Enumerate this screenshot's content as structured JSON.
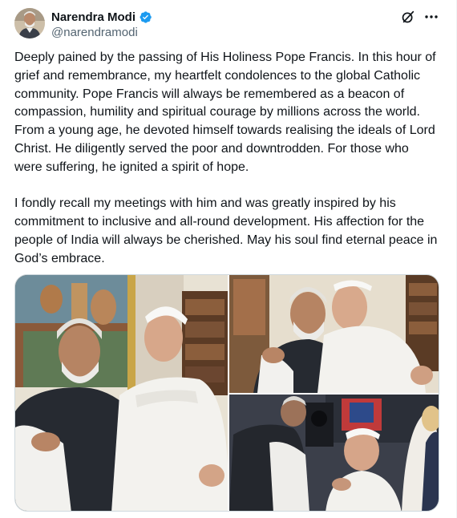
{
  "author": {
    "display_name": "Narendra Modi",
    "handle": "@narendramodi",
    "verified_icon": "verified-badge-icon"
  },
  "header_actions": {
    "grok_icon": "grok-icon",
    "more_icon": "more-options-icon"
  },
  "post": {
    "text": "Deeply pained by the passing of His Holiness Pope Francis. In this hour of grief and remembrance, my heartfelt condolences to the global Catholic community. Pope Francis will always be remembered as a beacon of compassion, humility and spiritual courage by millions across the world. From a young age, he devoted himself towards realising the ideals of Lord Christ. He diligently served the poor and downtrodden. For those who were suffering, he ignited a spirit of hope.\n\nI fondly recall my meetings with him and was greatly inspired by his commitment to inclusive and all-round development. His affection for the people of India will always be cherished. May his soul find eternal peace in God’s embrace."
  },
  "media": {
    "photos": [
      {
        "subject": "embrace-photo-main"
      },
      {
        "subject": "embrace-photo-closeup"
      },
      {
        "subject": "conversation-photo"
      }
    ]
  },
  "colors": {
    "text_primary": "#0f1419",
    "text_secondary": "#536471",
    "verified_blue": "#1d9bf0",
    "border": "#cfd9de"
  }
}
